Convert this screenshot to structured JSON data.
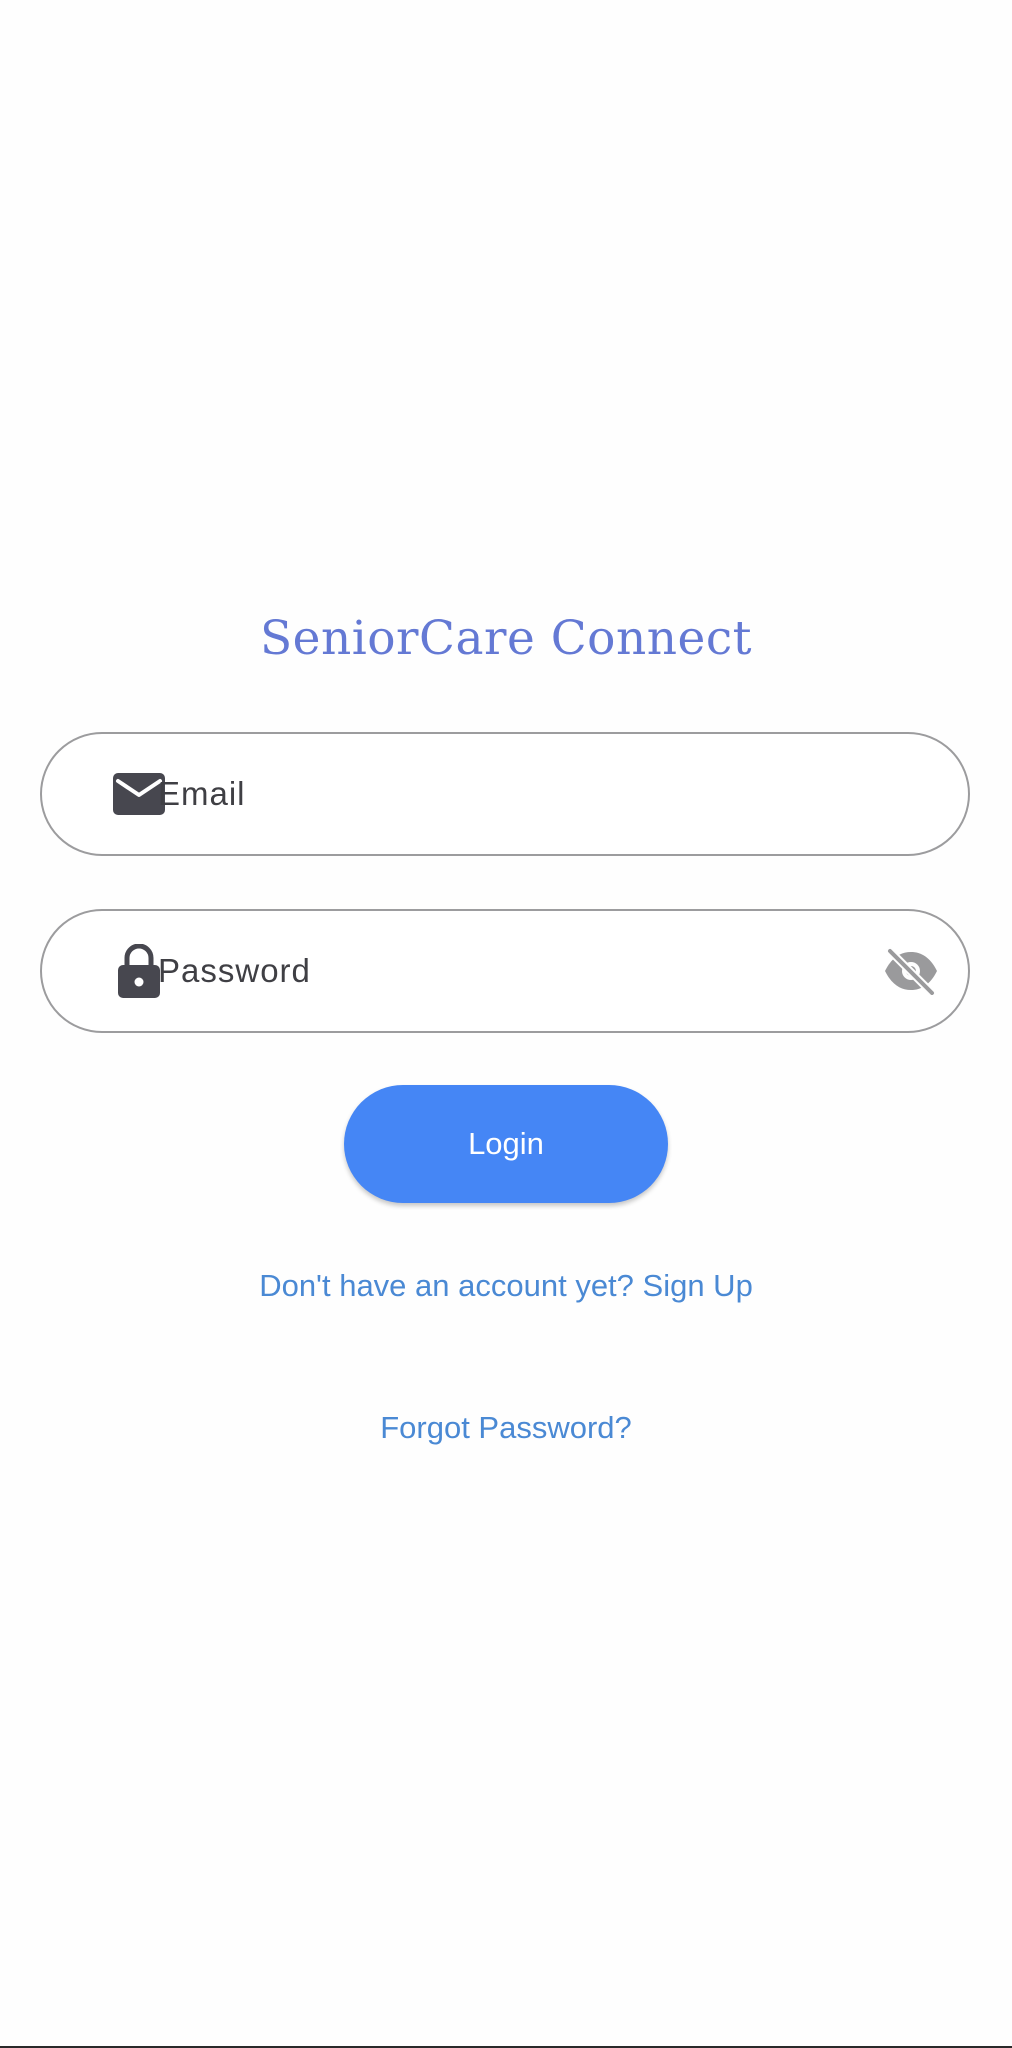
{
  "app": {
    "title": "SeniorCare Connect"
  },
  "form": {
    "email": {
      "label": "Email",
      "icon": "mail-icon"
    },
    "password": {
      "label": "Password",
      "icon": "lock-icon",
      "visibility_icon": "visibility-off-icon"
    },
    "login_label": "Login",
    "signup_link": "Don't have an account yet? Sign Up",
    "forgot_link": "Forgot Password?"
  },
  "colors": {
    "title": "#6479d4",
    "primary_button": "#4586f5",
    "link": "#4a89d4",
    "field_border": "#9c9c9e",
    "icon": "#47474f"
  }
}
